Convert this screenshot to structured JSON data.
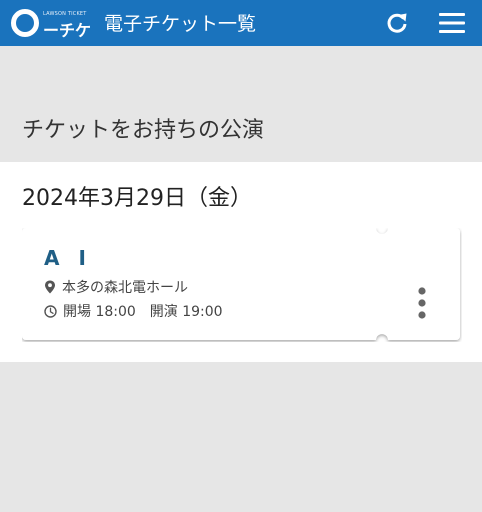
{
  "header": {
    "logo_small": "LAWSON TICKET",
    "logo_text": "ーチケ",
    "title": "電子チケット一覧",
    "refresh_icon": "refresh-icon",
    "menu_icon": "hamburger-menu-icon"
  },
  "section_heading": "チケットをお持ちの公演",
  "event_date": "2024年3月29日（金）",
  "tickets": [
    {
      "title": "A I",
      "venue": "本多の森北電ホール",
      "doors_open": "開場 18:00",
      "show_start": "開演 19:00",
      "more_icon": "more-vertical-icon"
    }
  ],
  "colors": {
    "header_bg": "#1a73bd",
    "page_bg": "#e6e6e6",
    "ticket_title": "#1f5f86"
  }
}
